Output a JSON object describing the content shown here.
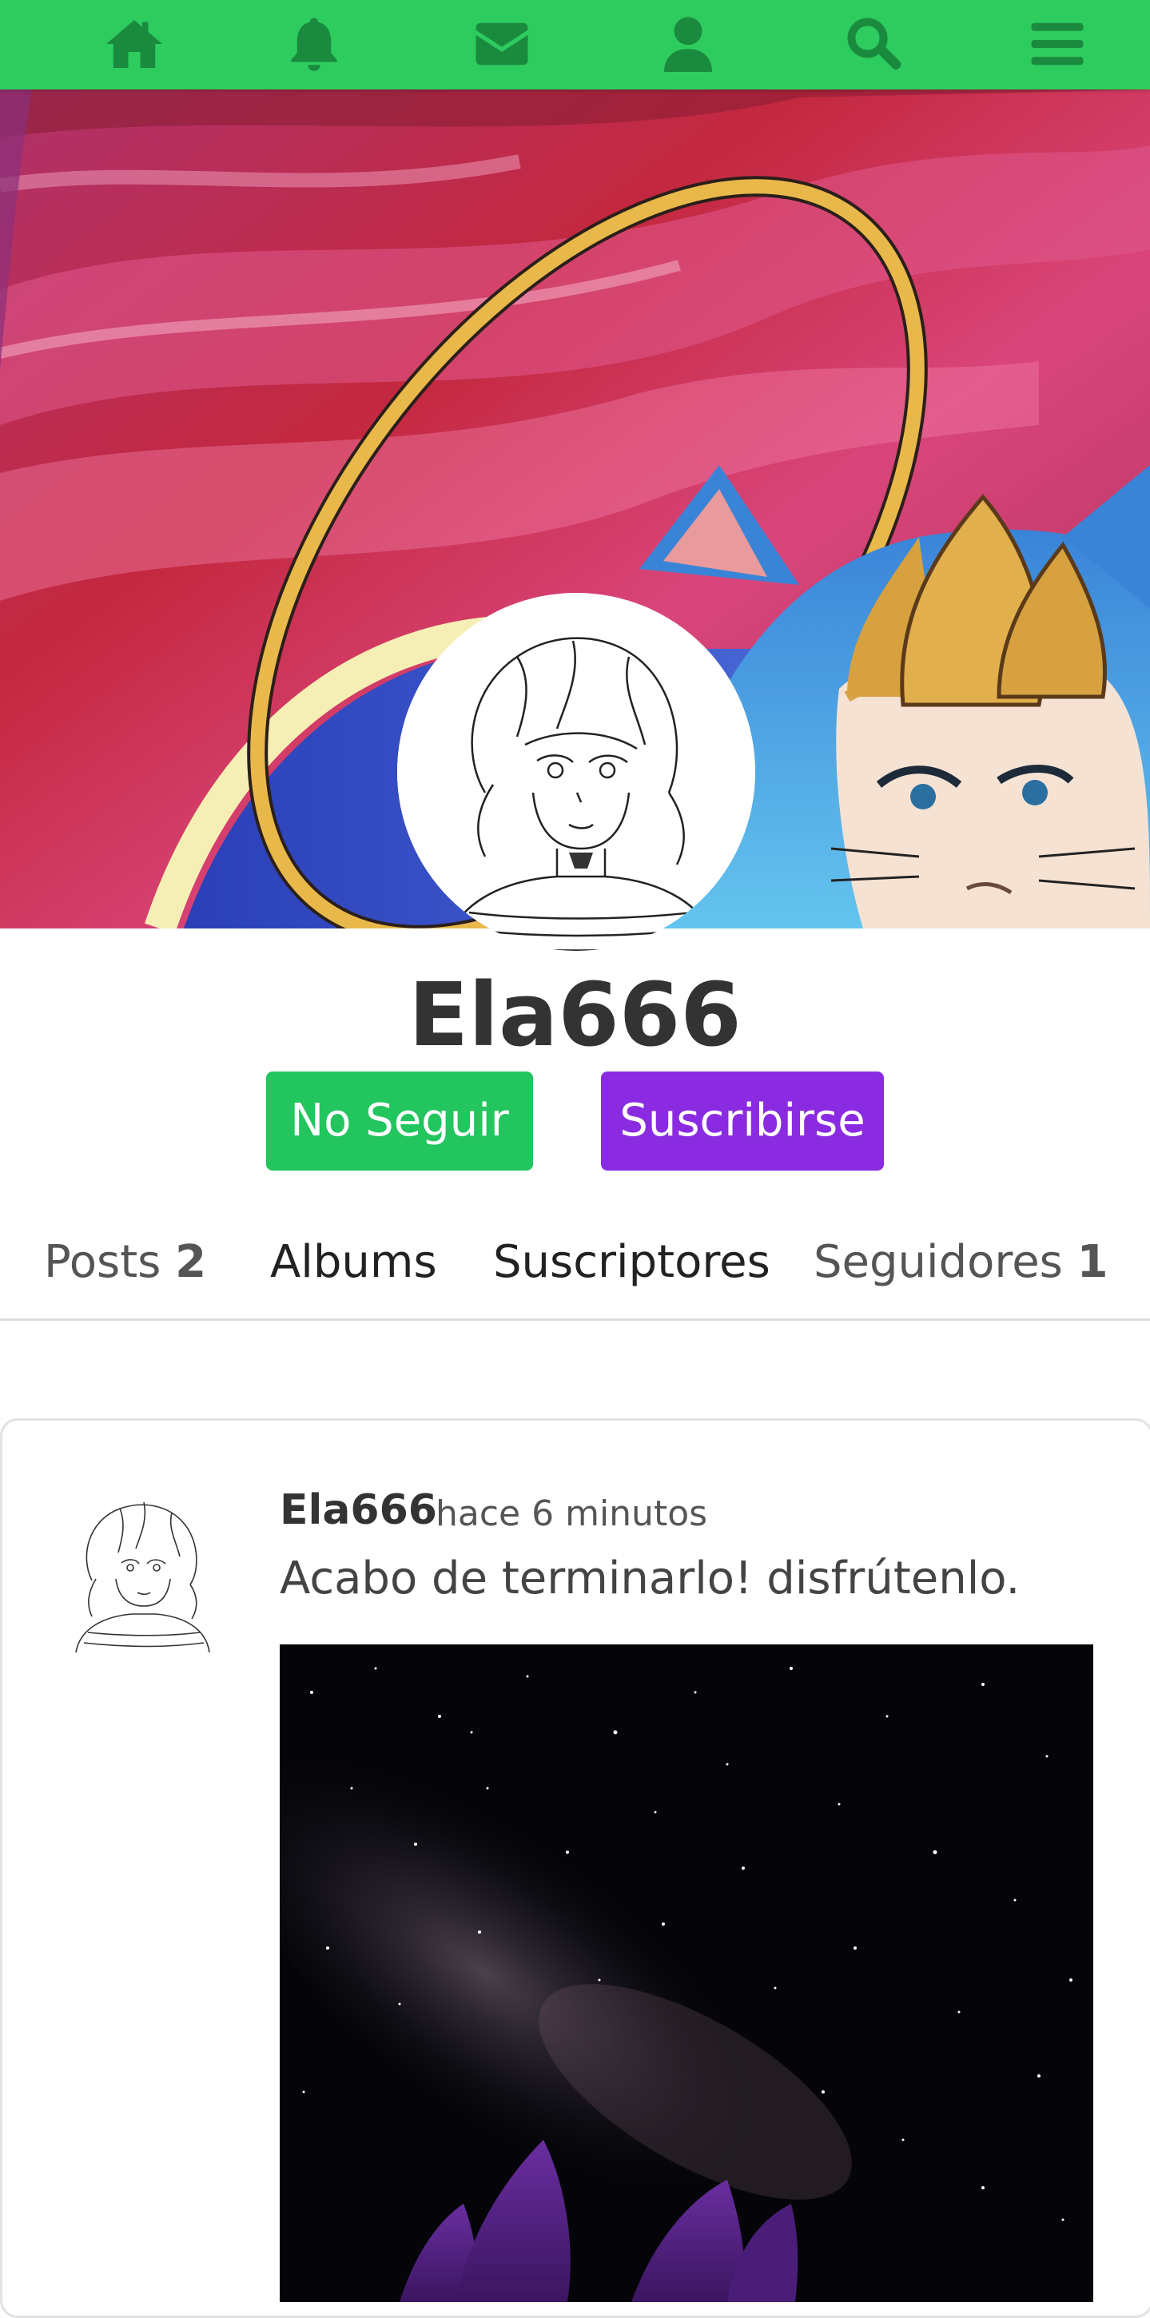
{
  "nav": {
    "items": [
      {
        "name": "home-icon"
      },
      {
        "name": "bell-icon"
      },
      {
        "name": "envelope-icon"
      },
      {
        "name": "user-icon"
      },
      {
        "name": "search-icon"
      },
      {
        "name": "menu-icon"
      }
    ],
    "bar_color": "#2ecc5f",
    "icon_color": "#1a8a3e"
  },
  "profile": {
    "username": "Ela666",
    "follow_button": "No Seguir",
    "subscribe_button": "Suscribirse",
    "follow_color": "#22c55e",
    "subscribe_color": "#8a2be2"
  },
  "tabs": {
    "posts_label": "Posts",
    "posts_count": "2",
    "albums_label": "Albums",
    "subscribers_label": "Suscriptores",
    "followers_label": "Seguidores",
    "followers_count": "1"
  },
  "post": {
    "author": "Ela666",
    "time": "hace 6 minutos",
    "text": "Acabo de terminarlo! disfrútenlo."
  }
}
